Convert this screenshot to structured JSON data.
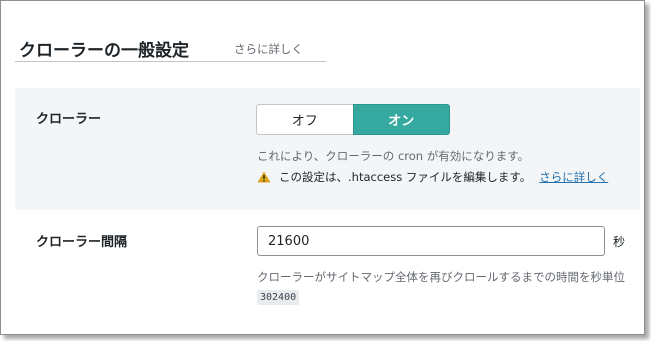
{
  "header": {
    "title": "クローラーの一般設定",
    "more_link": "さらに詳しく"
  },
  "crawler": {
    "label": "クローラー",
    "toggle_off_label": "オフ",
    "toggle_on_label": "オン",
    "selected": "オン",
    "description": "これにより、クローラーの cron が有効になります。",
    "warning_text": "この設定は、.htaccess ファイルを編集します。",
    "warning_link": "さらに詳しく",
    "warning_icon": "warning-icon"
  },
  "interval": {
    "label": "クローラー間隔",
    "value": "21600",
    "unit": "秒",
    "description": "クローラーがサイトマップ全体を再びクロールするまでの時間を秒単位",
    "recommended": "302400"
  },
  "colors": {
    "accent": "#35a9a0",
    "link": "#2271b1",
    "warning": "#dba617",
    "row_bg": "#f3f5f6"
  }
}
